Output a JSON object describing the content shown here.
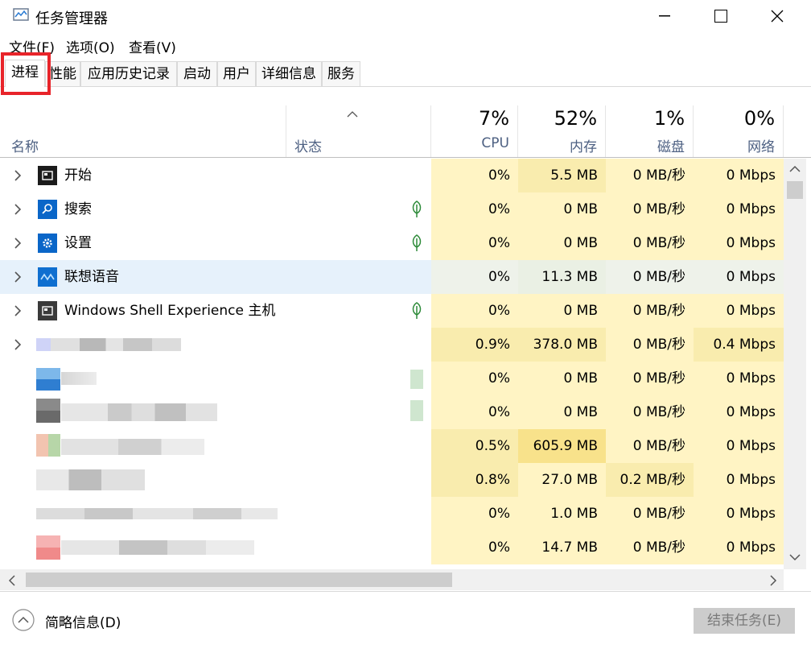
{
  "window": {
    "title": "任务管理器"
  },
  "menu": {
    "file": "文件(F)",
    "options": "选项(O)",
    "view": "查看(V)"
  },
  "tabs": [
    "进程",
    "性能",
    "应用历史记录",
    "启动",
    "用户",
    "详细信息",
    "服务"
  ],
  "header": {
    "name": "名称",
    "status": "状态",
    "cpu": {
      "pct": "7%",
      "label": "CPU"
    },
    "memory": {
      "pct": "52%",
      "label": "内存"
    },
    "disk": {
      "pct": "1%",
      "label": "磁盘"
    },
    "network": {
      "pct": "0%",
      "label": "网络"
    }
  },
  "rows": [
    {
      "name": "开始",
      "cpu": "0%",
      "mem": "5.5 MB",
      "disk": "0 MB/秒",
      "net": "0 Mbps"
    },
    {
      "name": "搜索",
      "cpu": "0%",
      "mem": "0 MB",
      "disk": "0 MB/秒",
      "net": "0 Mbps"
    },
    {
      "name": "设置",
      "cpu": "0%",
      "mem": "0 MB",
      "disk": "0 MB/秒",
      "net": "0 Mbps"
    },
    {
      "name": "联想语音",
      "cpu": "0%",
      "mem": "11.3 MB",
      "disk": "0 MB/秒",
      "net": "0 Mbps"
    },
    {
      "name": "Windows Shell Experience 主机",
      "cpu": "0%",
      "mem": "0 MB",
      "disk": "0 MB/秒",
      "net": "0 Mbps"
    },
    {
      "name": "",
      "cpu": "0.9%",
      "mem": "378.0 MB",
      "disk": "0 MB/秒",
      "net": "0.4 Mbps"
    },
    {
      "name": "",
      "cpu": "0%",
      "mem": "0 MB",
      "disk": "0 MB/秒",
      "net": "0 Mbps"
    },
    {
      "name": "",
      "cpu": "0%",
      "mem": "0 MB",
      "disk": "0 MB/秒",
      "net": "0 Mbps"
    },
    {
      "name": "",
      "cpu": "0.5%",
      "mem": "605.9 MB",
      "disk": "0 MB/秒",
      "net": "0 Mbps"
    },
    {
      "name": "",
      "cpu": "0.8%",
      "mem": "27.0 MB",
      "disk": "0.2 MB/秒",
      "net": "0 Mbps"
    },
    {
      "name": "",
      "cpu": "0%",
      "mem": "1.0 MB",
      "disk": "0 MB/秒",
      "net": "0 Mbps"
    },
    {
      "name": "",
      "cpu": "0%",
      "mem": "14.7 MB",
      "disk": "0 MB/秒",
      "net": "0 Mbps"
    }
  ],
  "footer": {
    "fewer_details": "简略信息(D)",
    "end_task": "结束任务(E)"
  },
  "colors": {
    "heat_light": "#fff4c4",
    "heat_mid": "#f9ecae",
    "heat_strong": "#f8e28b",
    "selection": "#e6f1fb",
    "highlight_box": "#e8242a"
  }
}
